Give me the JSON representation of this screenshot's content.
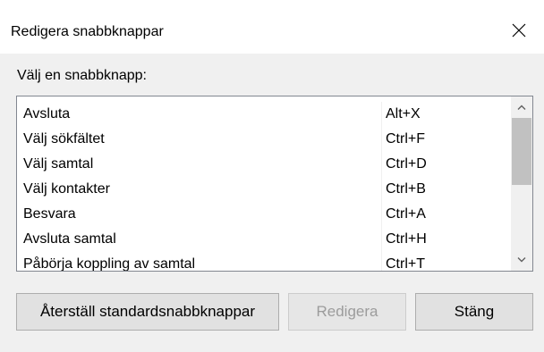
{
  "dialog": {
    "title": "Redigera snabbknappar",
    "prompt": "Välj en snabbknapp:"
  },
  "shortcuts": [
    {
      "name": "Avsluta",
      "key": "Alt+X"
    },
    {
      "name": "Välj sökfältet",
      "key": "Ctrl+F"
    },
    {
      "name": "Välj samtal",
      "key": "Ctrl+D"
    },
    {
      "name": "Välj kontakter",
      "key": "Ctrl+B"
    },
    {
      "name": "Besvara",
      "key": "Ctrl+A"
    },
    {
      "name": "Avsluta samtal",
      "key": "Ctrl+H"
    },
    {
      "name": "Påbörja koppling av samtal",
      "key": "Ctrl+T"
    }
  ],
  "buttons": {
    "reset_label": "Återställ standardsnabbknappar",
    "edit_label": "Redigera",
    "edit_enabled": false,
    "close_label": "Stäng"
  },
  "icons": {
    "close": "close-icon",
    "scroll_up": "chevron-up-icon",
    "scroll_down": "chevron-down-icon"
  }
}
